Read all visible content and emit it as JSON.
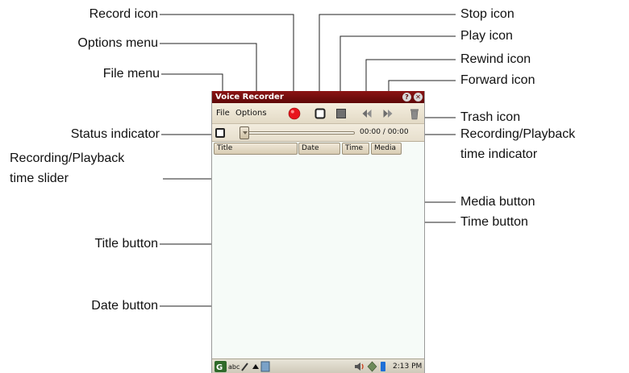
{
  "app": {
    "title": "Voice Recorder",
    "help_glyph": "?",
    "close_glyph": "✕"
  },
  "menus": {
    "file": "File",
    "options": "Options"
  },
  "playback": {
    "time": "00:00 / 00:00"
  },
  "columns": [
    "Title",
    "Date",
    "Time",
    "Media"
  ],
  "statusbar": {
    "keyboard": "abc",
    "clock": "2:13 PM"
  },
  "callouts": {
    "record_icon": "Record icon",
    "options_menu": "Options menu",
    "file_menu": "File menu",
    "status_indicator": "Status indicator",
    "time_slider_1": "Recording/Playback",
    "time_slider_2": "time slider",
    "title_button": "Title button",
    "date_button": "Date button",
    "stop_icon": "Stop icon",
    "play_icon": "Play icon",
    "rewind_icon": "Rewind icon",
    "forward_icon": "Forward icon",
    "trash_icon": "Trash icon",
    "time_indicator_1": "Recording/Playback",
    "time_indicator_2": "time indicator",
    "media_button": "Media button",
    "time_button": "Time button"
  },
  "colors": {
    "titlebar": "#7a0f0f",
    "record": "#e8141c",
    "screen_bg": "#f6fbf8",
    "toolbar_bg": "#ece4d2"
  }
}
